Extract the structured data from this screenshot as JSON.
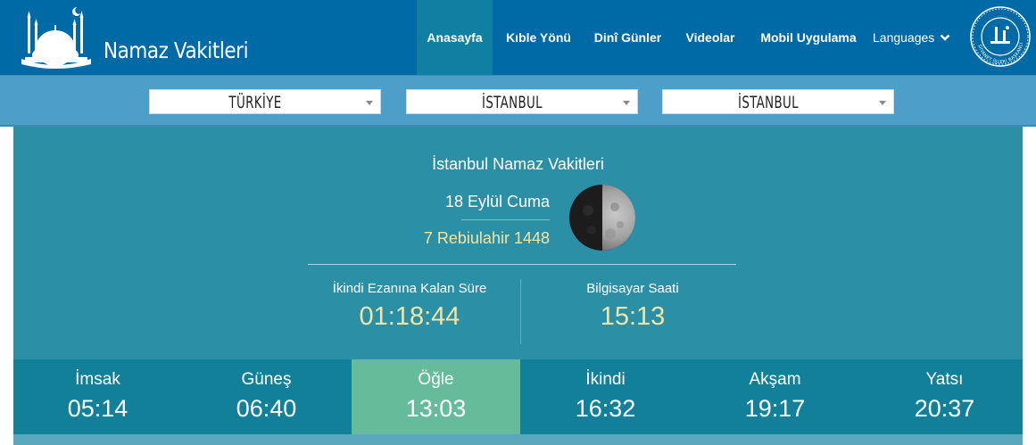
{
  "header": {
    "logo_text": "Namaz Vakitleri",
    "nav": [
      {
        "label": "Anasayfa",
        "active": true
      },
      {
        "label": "Kıble Yönü",
        "active": false
      },
      {
        "label": "Dinî Günler",
        "active": false
      },
      {
        "label": "Videolar",
        "active": false
      },
      {
        "label": "Mobil Uygulama",
        "active": false
      }
    ],
    "languages_label": "Languages",
    "seal_text": "DİYANET İŞLERİ BAŞKANLIĞI"
  },
  "selectors": {
    "country": "TÜRKİYE",
    "city": "İSTANBUL",
    "district": "İSTANBUL"
  },
  "info": {
    "title": "İstanbul Namaz Vakitleri",
    "gregorian_date": "18 Eylül Cuma",
    "hijri_date": "7 Rebiulahir 1448",
    "countdown_label": "İkindi Ezanına Kalan Süre",
    "countdown_value": "01:18:44",
    "clock_label": "Bilgisayar Saati",
    "clock_value": "15:13"
  },
  "times": [
    {
      "name": "İmsak",
      "time": "05:14",
      "active": false
    },
    {
      "name": "Güneş",
      "time": "06:40",
      "active": false
    },
    {
      "name": "Öğle",
      "time": "13:03",
      "active": true
    },
    {
      "name": "İkindi",
      "time": "16:32",
      "active": false
    },
    {
      "name": "Akşam",
      "time": "19:17",
      "active": false
    },
    {
      "name": "Yatsı",
      "time": "20:37",
      "active": false
    }
  ],
  "colors": {
    "header_bg": "#006aa6",
    "select_bar_bg": "#4d9ec8",
    "panel_bg": "#2b8fa6",
    "times_bg": "#13809a",
    "active_time_bg": "#66bb9b",
    "accent_text": "#f4e4a1"
  }
}
